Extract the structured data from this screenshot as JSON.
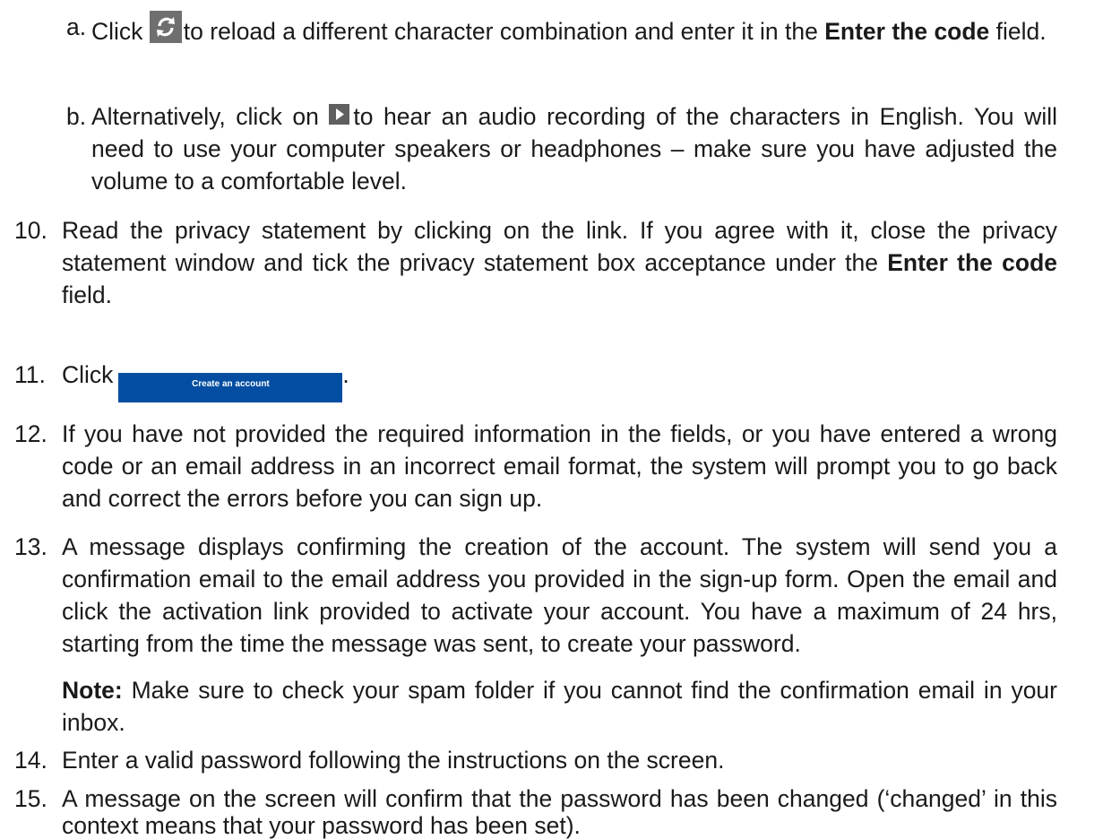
{
  "list": {
    "sub_a": {
      "marker": "a.",
      "t1": "Click ",
      "t2": "to reload a different character combination and enter it in the ",
      "bold": "Enter the code",
      "t3": " field."
    },
    "sub_b": {
      "marker": "b.",
      "t1": "Alternatively, click on ",
      "t2": "to hear an audio recording of the characters in English. You will need to use your computer speakers or headphones – make sure you have adjusted the volume to a comfortable level."
    },
    "item_10": {
      "marker": "10.",
      "t1": "Read the privacy statement by clicking on the link. If you agree with it, close the privacy statement window and tick the privacy statement box acceptance under the ",
      "bold": "Enter the code",
      "t2": " field."
    },
    "item_11": {
      "marker": "11.",
      "t1": "Click",
      "button_label": "Create an account",
      "t2": "."
    },
    "item_12": {
      "marker": "12.",
      "text": "If you have not provided the required information in the fields, or you have entered a wrong code or an email address in an incorrect email format, the system will prompt you to go back and correct the errors before you can sign up."
    },
    "item_13": {
      "marker": "13.",
      "text": "A message displays confirming the creation of the account. The system will send you a confirmation email to the email address you provided in the sign-up form. Open the email and click the activation link provided to activate your account. You have a maximum of 24 hrs, starting from the time the message was sent, to create your password."
    },
    "note": {
      "label": "Note:",
      "text": " Make sure to check your spam folder if you cannot find the confirmation email in your inbox."
    },
    "item_14": {
      "marker": "14.",
      "text": "Enter a valid password following the instructions on the screen."
    },
    "item_15": {
      "marker": "15.",
      "text": "A message on the screen will confirm that the password has been changed (‘changed’ in this context means that your password has been set)."
    }
  },
  "icons": {
    "reload": "reload-icon",
    "play": "play-icon"
  },
  "colors": {
    "button_bg": "#034ea2",
    "icon_bg": "#6f6f6f"
  }
}
